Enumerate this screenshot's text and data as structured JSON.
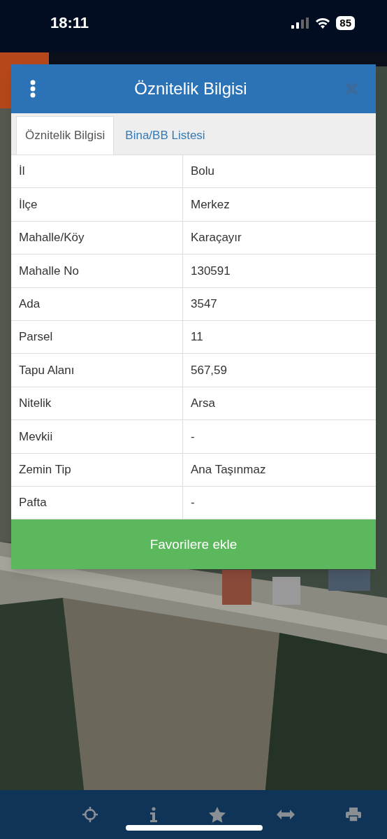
{
  "status_bar": {
    "time": "18:11",
    "battery": "85"
  },
  "dialog": {
    "title": "Öznitelik Bilgisi",
    "tabs": [
      {
        "label": "Öznitelik Bilgisi",
        "selected": true
      },
      {
        "label": "Bina/BB Listesi",
        "selected": false
      }
    ],
    "rows": [
      {
        "label": "İl",
        "value": "Bolu"
      },
      {
        "label": "İlçe",
        "value": "Merkez"
      },
      {
        "label": "Mahalle/Köy",
        "value": "Karaçayır"
      },
      {
        "label": "Mahalle No",
        "value": "130591"
      },
      {
        "label": "Ada",
        "value": "3547"
      },
      {
        "label": "Parsel",
        "value": "11"
      },
      {
        "label": "Tapu Alanı",
        "value": "567,59"
      },
      {
        "label": "Nitelik",
        "value": "Arsa"
      },
      {
        "label": "Mevkii",
        "value": "-"
      },
      {
        "label": "Zemin Tip",
        "value": "Ana Taşınmaz"
      },
      {
        "label": "Pafta",
        "value": "-"
      }
    ],
    "button": "Favorilere ekle"
  },
  "toolbar": [
    {
      "kind": "locate"
    },
    {
      "kind": "info"
    },
    {
      "kind": "star"
    },
    {
      "kind": "measure"
    },
    {
      "kind": "print"
    }
  ]
}
